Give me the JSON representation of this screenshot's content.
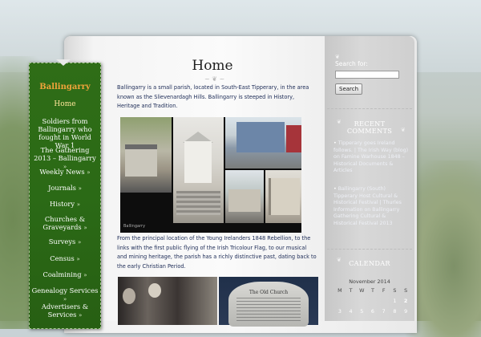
{
  "nav": {
    "site_title": "Ballingarry",
    "items": [
      {
        "label": "Home",
        "arrow": ""
      },
      {
        "label": "Soldiers from Ballingarry who fought in World War 1",
        "arrow": ""
      },
      {
        "label": "The Gathering 2013 – Ballingarry",
        "arrow": "»"
      },
      {
        "label": "Weekly News",
        "arrow": "»"
      },
      {
        "label": "Journals",
        "arrow": "»"
      },
      {
        "label": "History",
        "arrow": "»"
      },
      {
        "label": "Churches & Graveyards",
        "arrow": "»"
      },
      {
        "label": "Surveys",
        "arrow": "»"
      },
      {
        "label": "Census",
        "arrow": "»"
      },
      {
        "label": "Coalmining",
        "arrow": "»"
      },
      {
        "label": "Genealogy Services",
        "arrow": "»"
      },
      {
        "label": "Advertisers & Services",
        "arrow": "»"
      }
    ]
  },
  "main": {
    "title": "Home",
    "intro": "Ballingarry is a small parish, located in South-East Tipperary, in the area known as the Slievenardagh Hills. Ballingarry is steeped in History, Heritage and Tradition.",
    "collage_caption": "Ballingarry",
    "paragraph2": "From the principal location of the Young Irelanders 1848 Rebellion, to the links with the first public flying of the Irish Tricolour Flag, to our musical and mining heritage, the parish has a richly distinctive past, dating back to the early Christian Period.",
    "stone_title": "The Old Church"
  },
  "sidebar": {
    "search": {
      "label": "Search for:",
      "value": "",
      "button": "Search"
    },
    "recent_comments": {
      "title_line1": "RECENT",
      "title_line2": "COMMENTS",
      "items": [
        "Tipperary goes Ireland follows. | The Irish Way (blog) on Famine Warhouse 1848 – Historical Documents & Articles",
        "Ballingarry (South) Tipperary Host Cultural & Historical Festival | Thurles Information on Ballingarry Gathering Cultural & Historical Festival 2013"
      ]
    },
    "calendar": {
      "title": "CALENDAR",
      "caption": "November 2014",
      "weekdays": [
        "M",
        "T",
        "W",
        "T",
        "F",
        "S",
        "S"
      ],
      "rows": [
        [
          "",
          "",
          "",
          "",
          "",
          "1",
          "2"
        ],
        [
          "3",
          "4",
          "5",
          "6",
          "7",
          "8",
          "9"
        ]
      ]
    }
  }
}
